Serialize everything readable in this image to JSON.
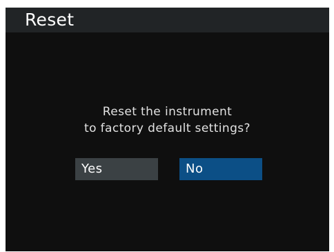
{
  "dialog": {
    "title": "Reset",
    "message_line1": "Reset the instrument",
    "message_line2": "to factory default settings?",
    "yes_label": "Yes",
    "no_label": "No",
    "selected_option": "No"
  },
  "colors": {
    "screen_bg": "#0f0f0f",
    "title_bar_bg": "#212426",
    "button_inactive_bg": "#3b4144",
    "button_selected_bg": "#0c4f86",
    "text": "#ffffff"
  }
}
